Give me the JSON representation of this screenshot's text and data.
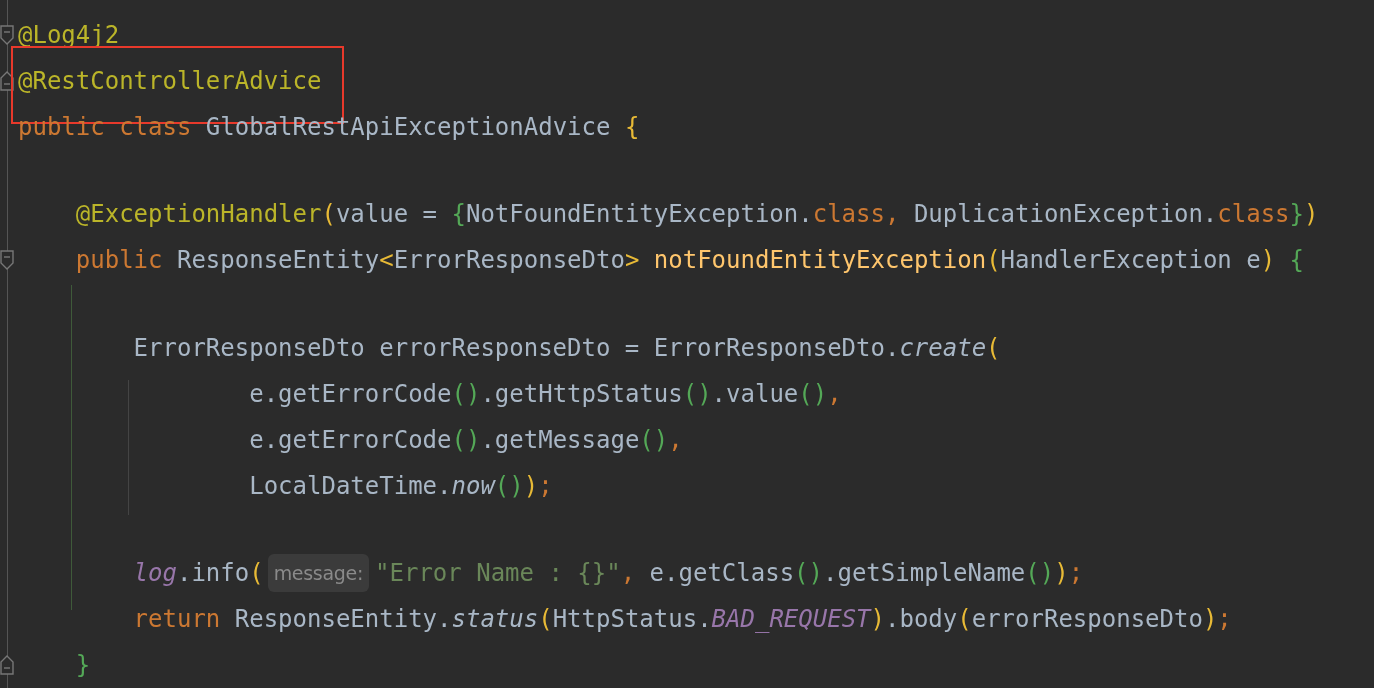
{
  "editor": {
    "lines": [
      {
        "kind": "code",
        "fold_start": true,
        "fold_end": false,
        "highlighted": false,
        "segments": [
          [
            {
              "text": "@Log4j2",
              "kind": "annotation"
            }
          ]
        ]
      },
      {
        "kind": "code",
        "fold_start": false,
        "fold_end": true,
        "highlighted": true,
        "segments": [
          [
            {
              "text": "@RestControllerAdvice",
              "kind": "annotation"
            }
          ]
        ]
      },
      {
        "kind": "code",
        "fold_start": false,
        "fold_end": false,
        "highlighted": false,
        "segments": [
          [
            {
              "text": "public class ",
              "kind": "keyword"
            },
            {
              "text": "GlobalRestApiExceptionAdvice ",
              "kind": "plain"
            },
            {
              "text": "{",
              "kind": "bracket1"
            }
          ]
        ]
      },
      {
        "kind": "blank",
        "fold_start": false,
        "fold_end": false,
        "highlighted": false
      },
      {
        "kind": "code",
        "fold_start": false,
        "fold_end": false,
        "highlighted": false,
        "segments": [
          [
            {
              "text": "    @ExceptionHandler",
              "kind": "annotation"
            },
            {
              "text": "(",
              "kind": "bracket1"
            },
            {
              "text": "value = ",
              "kind": "plain"
            },
            {
              "text": "{",
              "kind": "bracket2"
            },
            {
              "text": "NotFoundEntityException.",
              "kind": "plain"
            },
            {
              "text": "class",
              "kind": "keyword"
            },
            {
              "text": ", ",
              "kind": "punct"
            },
            {
              "text": "DuplicationException.",
              "kind": "plain"
            },
            {
              "text": "class",
              "kind": "keyword"
            },
            {
              "text": "}",
              "kind": "bracket2"
            },
            {
              "text": ")",
              "kind": "bracket1"
            }
          ]
        ]
      },
      {
        "kind": "code",
        "fold_start": true,
        "fold_end": false,
        "highlighted": false,
        "segments": [
          [
            {
              "text": "    public ",
              "kind": "keyword"
            },
            {
              "text": "ResponseEntity",
              "kind": "plain"
            },
            {
              "text": "<",
              "kind": "bracket1"
            },
            {
              "text": "ErrorResponseDto",
              "kind": "plain"
            },
            {
              "text": "> ",
              "kind": "bracket1"
            },
            {
              "text": "notFoundEntityException",
              "kind": "method"
            },
            {
              "text": "(",
              "kind": "bracket1"
            },
            {
              "text": "HandlerException e",
              "kind": "plain"
            },
            {
              "text": ") ",
              "kind": "bracket1"
            },
            {
              "text": "{",
              "kind": "bracket2"
            }
          ]
        ]
      },
      {
        "kind": "blank",
        "fold_start": false,
        "fold_end": false,
        "highlighted": false
      },
      {
        "kind": "code",
        "fold_start": false,
        "fold_end": false,
        "highlighted": false,
        "segments": [
          [
            {
              "text": "        ErrorResponseDto errorResponseDto = ErrorResponseDto.",
              "kind": "plain"
            },
            {
              "text": "create",
              "kind": "italic"
            },
            {
              "text": "(",
              "kind": "bracket1"
            }
          ]
        ]
      },
      {
        "kind": "code",
        "fold_start": false,
        "fold_end": false,
        "highlighted": false,
        "segments": [
          [
            {
              "text": "                e.getErrorCode",
              "kind": "plain"
            },
            {
              "text": "()",
              "kind": "bracket2"
            },
            {
              "text": ".getHttpStatus",
              "kind": "plain"
            },
            {
              "text": "()",
              "kind": "bracket2"
            },
            {
              "text": ".value",
              "kind": "plain"
            },
            {
              "text": "()",
              "kind": "bracket2"
            },
            {
              "text": ",",
              "kind": "punct"
            }
          ]
        ]
      },
      {
        "kind": "code",
        "fold_start": false,
        "fold_end": false,
        "highlighted": false,
        "segments": [
          [
            {
              "text": "                e.getErrorCode",
              "kind": "plain"
            },
            {
              "text": "()",
              "kind": "bracket2"
            },
            {
              "text": ".getMessage",
              "kind": "plain"
            },
            {
              "text": "()",
              "kind": "bracket2"
            },
            {
              "text": ",",
              "kind": "punct"
            }
          ]
        ]
      },
      {
        "kind": "code",
        "fold_start": false,
        "fold_end": false,
        "highlighted": false,
        "segments": [
          [
            {
              "text": "                LocalDateTime.",
              "kind": "plain"
            },
            {
              "text": "now",
              "kind": "italic"
            },
            {
              "text": "()",
              "kind": "bracket2"
            },
            {
              "text": ")",
              "kind": "bracket1"
            },
            {
              "text": ";",
              "kind": "punct"
            }
          ]
        ]
      },
      {
        "kind": "blank",
        "fold_start": false,
        "fold_end": false,
        "highlighted": false
      },
      {
        "kind": "code",
        "fold_start": false,
        "fold_end": false,
        "highlighted": false,
        "hint": "message:",
        "segments": [
          [
            {
              "text": "        log",
              "kind": "field"
            },
            {
              "text": ".info",
              "kind": "plain"
            },
            {
              "text": "(",
              "kind": "bracket1"
            }
          ],
          [
            {
              "text": "\"Error Name : {}\"",
              "kind": "string"
            },
            {
              "text": ", ",
              "kind": "punct"
            },
            {
              "text": "e.getClass",
              "kind": "plain"
            },
            {
              "text": "()",
              "kind": "bracket2"
            },
            {
              "text": ".getSimpleName",
              "kind": "plain"
            },
            {
              "text": "()",
              "kind": "bracket2"
            },
            {
              "text": ")",
              "kind": "bracket1"
            },
            {
              "text": ";",
              "kind": "punct"
            }
          ]
        ]
      },
      {
        "kind": "code",
        "fold_start": false,
        "fold_end": false,
        "highlighted": false,
        "segments": [
          [
            {
              "text": "        return ",
              "kind": "keyword"
            },
            {
              "text": "ResponseEntity.",
              "kind": "plain"
            },
            {
              "text": "status",
              "kind": "italic"
            },
            {
              "text": "(",
              "kind": "bracket1"
            },
            {
              "text": "HttpStatus.",
              "kind": "plain"
            },
            {
              "text": "BAD_REQUEST",
              "kind": "field"
            },
            {
              "text": ")",
              "kind": "bracket1"
            },
            {
              "text": ".body",
              "kind": "plain"
            },
            {
              "text": "(",
              "kind": "bracket1"
            },
            {
              "text": "errorResponseDto",
              "kind": "plain"
            },
            {
              "text": ")",
              "kind": "bracket1"
            },
            {
              "text": ";",
              "kind": "punct"
            }
          ]
        ]
      },
      {
        "kind": "code",
        "fold_start": false,
        "fold_end": true,
        "highlighted": false,
        "segments": [
          [
            {
              "text": "    }",
              "kind": "bracket2"
            }
          ]
        ]
      }
    ]
  }
}
